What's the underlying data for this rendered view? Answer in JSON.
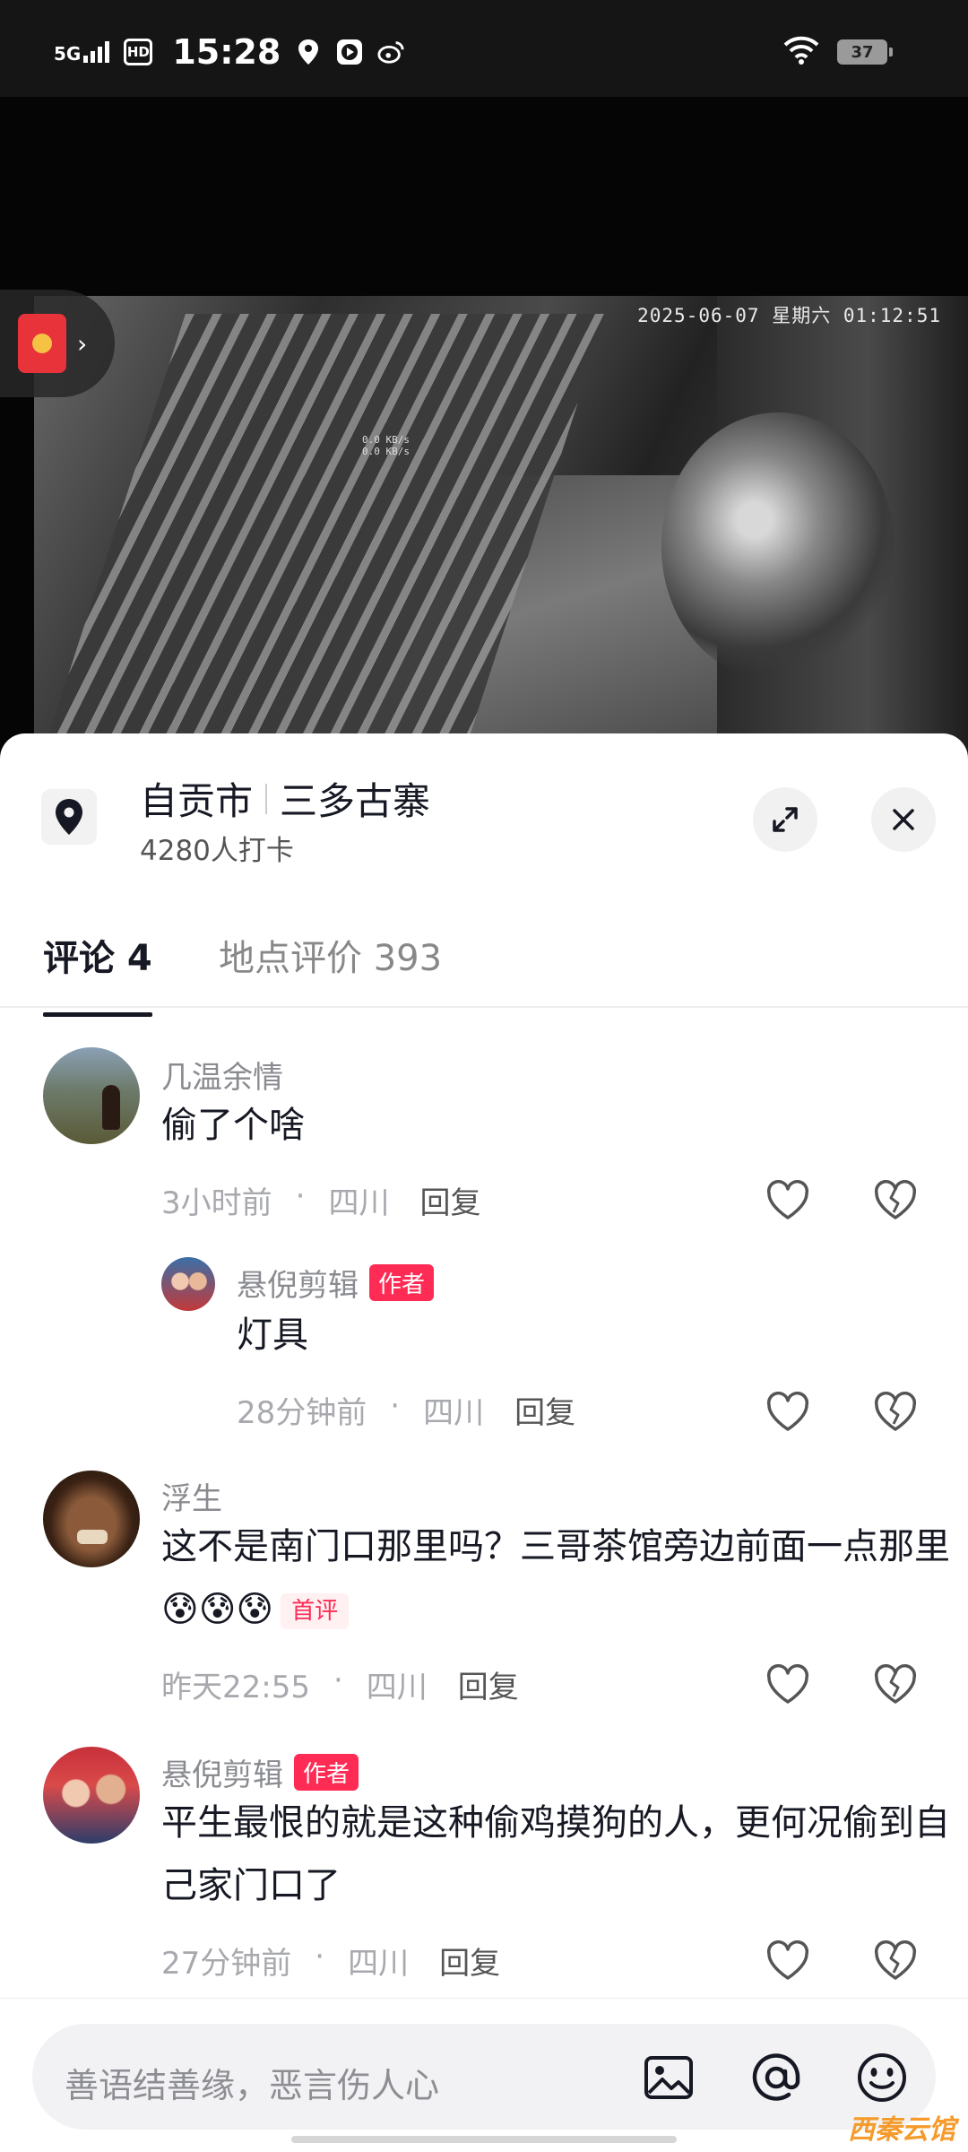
{
  "status_bar": {
    "network": "5G",
    "hd": "HD",
    "time": "15:28",
    "battery": "37"
  },
  "video": {
    "timestamp": "2025-06-07  星期六  01:12:51",
    "speed": [
      "0.0 KB/s",
      "0.0 KB/s"
    ]
  },
  "location": {
    "city": "自贡市",
    "place": "三多古寨",
    "checkins": "4280人打卡"
  },
  "tabs": [
    {
      "label": "评论 4"
    },
    {
      "label": "地点评价 393"
    }
  ],
  "comments": [
    {
      "name": "几温余情",
      "text": "偷了个啥",
      "time": "3小时前",
      "region": "四川",
      "reply": "回复"
    },
    {
      "name": "悬倪剪辑",
      "tag": "作者",
      "text": "灯具",
      "time": "28分钟前",
      "region": "四川",
      "reply": "回复"
    },
    {
      "name": "浮生",
      "text": "这不是南门口那里吗？三哥茶馆旁边前面一点那里",
      "emoji": "😰😰😰",
      "badge": "首评",
      "time": "昨天22:55",
      "region": "四川",
      "reply": "回复"
    },
    {
      "name": "悬倪剪辑",
      "tag": "作者",
      "text": "平生最恨的就是这种偷鸡摸狗的人，更何况偷到自己家门口了",
      "time": "27分钟前",
      "region": "四川",
      "reply": "回复"
    }
  ],
  "input": {
    "placeholder": "善语结善缘，恶言伤人心"
  },
  "watermark": "西秦云馆",
  "colors": {
    "accent": "#fe2c55",
    "text_primary": "#161823",
    "text_secondary": "#8a8b91"
  }
}
